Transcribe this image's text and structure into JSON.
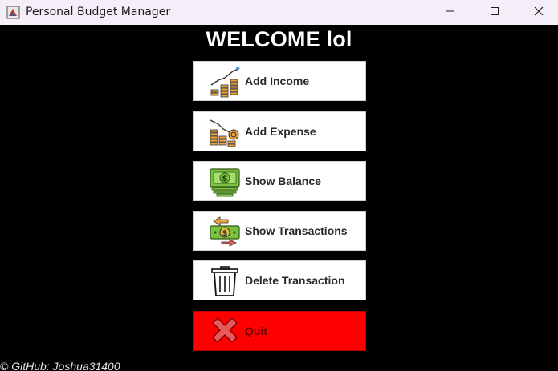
{
  "window": {
    "title": "Personal Budget Manager",
    "minimize_icon": "minimize-icon",
    "maximize_icon": "maximize-icon",
    "close_icon": "close-icon"
  },
  "welcome": "WELCOME lol",
  "buttons": [
    {
      "label": "Add Income",
      "icon": "income-growth-icon"
    },
    {
      "label": "Add Expense",
      "icon": "expense-coins-icon"
    },
    {
      "label": "Show Balance",
      "icon": "cash-stack-icon"
    },
    {
      "label": "Show Transactions",
      "icon": "money-exchange-icon"
    },
    {
      "label": "Delete Transaction",
      "icon": "trash-can-icon"
    },
    {
      "label": "Quit",
      "icon": "red-x-icon"
    }
  ],
  "footer": "© GitHub: Joshua31400",
  "colors": {
    "background": "#000000",
    "button": "#ffffff",
    "quit": "#ff0000"
  }
}
